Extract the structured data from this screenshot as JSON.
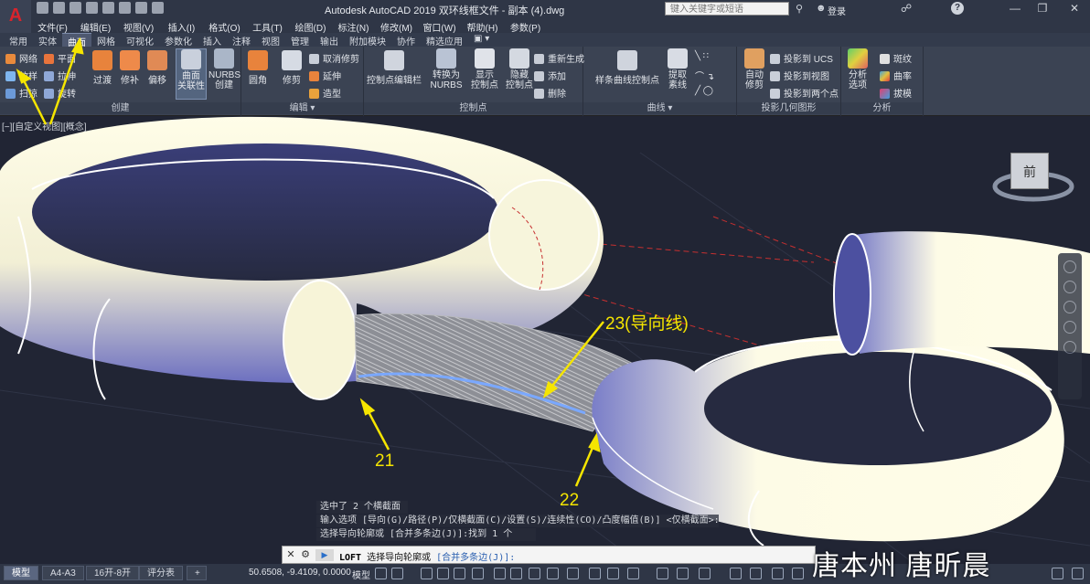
{
  "app": {
    "logo_letter": "A",
    "title": "Autodesk AutoCAD 2019   双环线框文件 - 副本 (4).dwg",
    "search_placeholder": "键入关键字或短语",
    "login_label": "登录",
    "help_label": "?"
  },
  "menu": [
    "文件(F)",
    "编辑(E)",
    "视图(V)",
    "插入(I)",
    "格式(O)",
    "工具(T)",
    "绘图(D)",
    "标注(N)",
    "修改(M)",
    "窗口(W)",
    "帮助(H)",
    "参数(P)"
  ],
  "ribbon_tabs": [
    {
      "label": "常用",
      "active": false
    },
    {
      "label": "实体",
      "active": false
    },
    {
      "label": "曲面",
      "active": true
    },
    {
      "label": "网格",
      "active": false
    },
    {
      "label": "可视化",
      "active": false
    },
    {
      "label": "参数化",
      "active": false
    },
    {
      "label": "插入",
      "active": false
    },
    {
      "label": "注释",
      "active": false
    },
    {
      "label": "视图",
      "active": false
    },
    {
      "label": "管理",
      "active": false
    },
    {
      "label": "输出",
      "active": false
    },
    {
      "label": "附加模块",
      "active": false
    },
    {
      "label": "协作",
      "active": false
    },
    {
      "label": "精选应用",
      "active": false
    }
  ],
  "ribbon": {
    "create": {
      "title": "创建",
      "net": "网络",
      "plane": "平面",
      "loft": "放样",
      "extrude": "拉伸",
      "sweep": "扫掠",
      "revolve": "旋转",
      "blend": "过渡",
      "patch": "修补",
      "offset": "偏移",
      "assoc": "曲面\n关联性",
      "nurbs": "NURBS\n创建"
    },
    "edit": {
      "title": "编辑",
      "fillet": "圆角",
      "trim": "修剪",
      "untrim": "取消修剪",
      "extend": "延伸",
      "sculpt": "造型"
    },
    "control": {
      "title": "控制点",
      "cv_edit": "控制点编辑栏",
      "to_nurbs": "转换为\nNURBS",
      "show_cv": "显示\n控制点",
      "hide_cv": "隐藏\n控制点",
      "rebuild": "重新生成",
      "add": "添加",
      "remove": "删除"
    },
    "curves": {
      "title": "曲线",
      "spline_cv": "样条曲线控制点",
      "extract": "提取\n素线"
    },
    "project": {
      "title": "投影几何图形",
      "auto_trim": "自动\n修剪",
      "to_ucs": "投影到 UCS",
      "to_view": "投影到视图",
      "to_two": "投影到两个点"
    },
    "analysis": {
      "title": "分析",
      "options": "分析\n选项",
      "zebra": "斑纹",
      "curvature": "曲率",
      "draft": "拔模"
    }
  },
  "viewport": {
    "label": "[−][自定义视图][概念]",
    "viewcube_face": "前",
    "callouts": {
      "c21": "21",
      "c22": "22",
      "c23": "23(导向线)"
    },
    "colors": {
      "background": "#212534",
      "torus_light": "#fffde8",
      "torus_dark": "#5a5fb0",
      "callout": "#f5e500",
      "guide": "#7aa8ff"
    }
  },
  "command": {
    "history": [
      "选中了 2 个横截面",
      "输入选项 [导向(G)/路径(P)/仅横截面(C)/设置(S)/连续性(CO)/凸度幅值(B)] <仅横截面>: G",
      "选择导向轮廓或 [合并多条边(J)]:找到 1 个"
    ],
    "prompt_icon": "▶",
    "command_name": "LOFT",
    "prompt": " 选择导向轮廓或 ",
    "option": "[合并多条边(J)]:"
  },
  "status": {
    "layout_tabs": [
      {
        "label": "模型",
        "active": true
      },
      {
        "label": "A4-A3",
        "active": false
      },
      {
        "label": "16开-8开",
        "active": false
      },
      {
        "label": "评分表",
        "active": false
      }
    ],
    "coords": "50.6508, -9.4109, 0.0000",
    "model_label": "模型"
  },
  "watermark": "唐本州 唐昕晨"
}
